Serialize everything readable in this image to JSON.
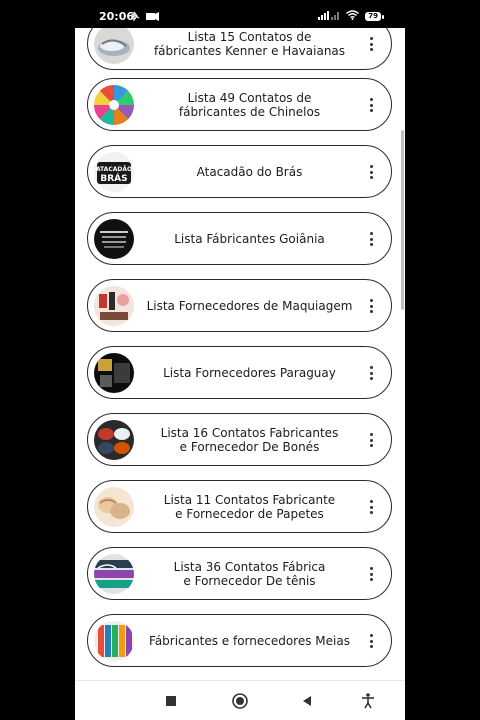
{
  "status_bar": {
    "time": "20:06",
    "battery": "79"
  },
  "links": [
    {
      "label": "Lista 15 Contatos de\nfábricantes Kenner e Havaianas",
      "thumb": "thumb-sandals"
    },
    {
      "label": "Lista 49 Contatos de\nfábricantes de Chinelos",
      "thumb": "thumb-colorful-slippers"
    },
    {
      "label": "Atacadão do Brás",
      "thumb": "thumb-atacadao-logo",
      "thumb_text": [
        "ATACADÃO",
        "BRÁS"
      ]
    },
    {
      "label": "Lista Fábricantes Goiânia",
      "thumb": "thumb-goiania-flyer"
    },
    {
      "label": "Lista Fornecedores de Maquiagem",
      "thumb": "thumb-makeup"
    },
    {
      "label": "Lista Fornecedores Paraguay",
      "thumb": "thumb-paraguay"
    },
    {
      "label": "Lista 16 Contatos Fabricantes\ne Fornecedor De Bonés",
      "thumb": "thumb-caps"
    },
    {
      "label": "Lista 11 Contatos Fabricante\ne Fornecedor de Papetes",
      "thumb": "thumb-papetes"
    },
    {
      "label": "Lista 36 Contatos Fábrica\ne Fornecedor De tênis",
      "thumb": "thumb-sneakers"
    },
    {
      "label": "Fábricantes e fornecedores Meias",
      "thumb": "thumb-socks"
    }
  ],
  "nav": {
    "recent": "recent-apps-icon",
    "home": "home-icon",
    "back": "back-icon",
    "accessibility": "accessibility-icon"
  }
}
